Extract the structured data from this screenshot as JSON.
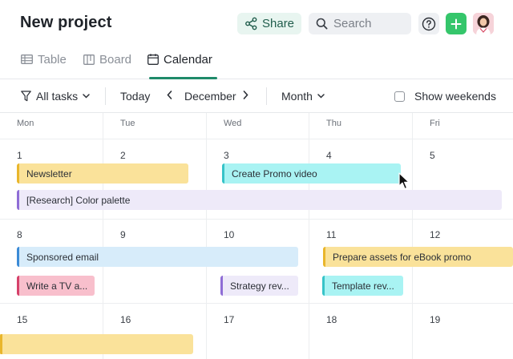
{
  "header": {
    "title": "New project",
    "share_label": "Share",
    "search_placeholder": "Search"
  },
  "tabs": [
    {
      "label": "Table",
      "icon": "table-icon",
      "active": false
    },
    {
      "label": "Board",
      "icon": "board-icon",
      "active": false
    },
    {
      "label": "Calendar",
      "icon": "calendar-icon",
      "active": true
    }
  ],
  "toolbar": {
    "filter_label": "All tasks",
    "today_label": "Today",
    "month_label": "December",
    "view_label": "Month",
    "weekends_label": "Show weekends",
    "weekends_checked": false
  },
  "calendar": {
    "weekdays": [
      "Mon",
      "Tue",
      "Wed",
      "Thu",
      "Fri"
    ],
    "weeks": [
      {
        "days": [
          "1",
          "2",
          "3",
          "4",
          "5"
        ]
      },
      {
        "days": [
          "8",
          "9",
          "10",
          "11",
          "12"
        ]
      },
      {
        "days": [
          "15",
          "16",
          "17",
          "18",
          "19"
        ]
      }
    ],
    "events": [
      {
        "title": "Newsletter",
        "color": "yellow"
      },
      {
        "title": "Create Promo video",
        "color": "cyan"
      },
      {
        "title": "[Research] Color palette",
        "color": "purple"
      },
      {
        "title": "Sponsored email",
        "color": "blue"
      },
      {
        "title": "Prepare assets for eBook promo",
        "color": "yellow"
      },
      {
        "title": "Write a TV a...",
        "color": "pink"
      },
      {
        "title": "Strategy rev...",
        "color": "purple"
      },
      {
        "title": "Template rev...",
        "color": "cyan"
      },
      {
        "title": "",
        "color": "yellow"
      }
    ]
  },
  "colors": {
    "accent": "#1f8a6a",
    "add_button": "#35c66b"
  }
}
